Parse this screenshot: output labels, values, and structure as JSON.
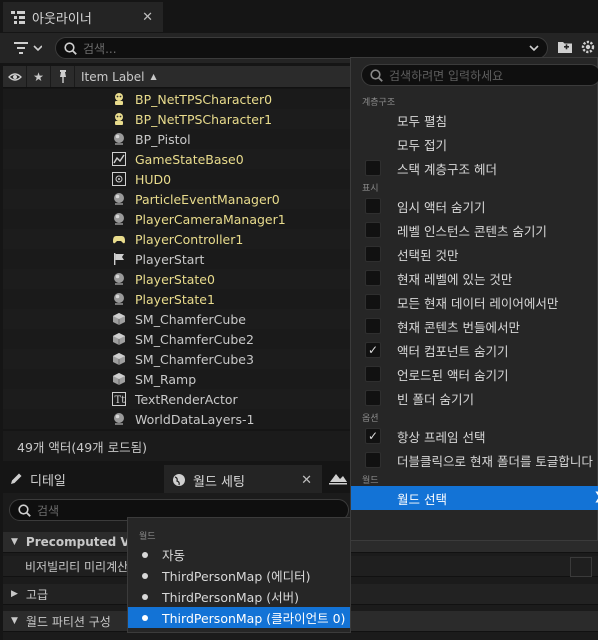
{
  "outliner": {
    "tab_title": "아웃라이너",
    "close_glyph": "✕",
    "search_placeholder": "검색...",
    "columns": {
      "item_label": "Item Label"
    },
    "rows": [
      {
        "label": "BP_NetTPSCharacter0",
        "icon": "pawn-icon",
        "highlight": true
      },
      {
        "label": "BP_NetTPSCharacter1",
        "icon": "pawn-icon",
        "highlight": true
      },
      {
        "label": "BP_Pistol",
        "icon": "actor-icon",
        "highlight": false
      },
      {
        "label": "GameStateBase0",
        "icon": "graph-icon",
        "highlight": true
      },
      {
        "label": "HUD0",
        "icon": "hud-icon",
        "highlight": true
      },
      {
        "label": "ParticleEventManager0",
        "icon": "actor-icon",
        "highlight": true
      },
      {
        "label": "PlayerCameraManager1",
        "icon": "actor-icon",
        "highlight": true
      },
      {
        "label": "PlayerController1",
        "icon": "gamepad-icon",
        "highlight": true
      },
      {
        "label": "PlayerStart",
        "icon": "flag-icon",
        "highlight": false
      },
      {
        "label": "PlayerState0",
        "icon": "actor-icon",
        "highlight": true
      },
      {
        "label": "PlayerState1",
        "icon": "actor-icon",
        "highlight": true
      },
      {
        "label": "SM_ChamferCube",
        "icon": "cube-icon",
        "highlight": false
      },
      {
        "label": "SM_ChamferCube2",
        "icon": "cube-icon",
        "highlight": false
      },
      {
        "label": "SM_ChamferCube3",
        "icon": "cube-icon",
        "highlight": false
      },
      {
        "label": "SM_Ramp",
        "icon": "cube-icon",
        "highlight": false
      },
      {
        "label": "TextRenderActor",
        "icon": "text-icon",
        "highlight": false
      },
      {
        "label": "WorldDataLayers-1",
        "icon": "actor-icon",
        "highlight": false
      }
    ],
    "footer_status": "49개 액터(49개 로드됨)"
  },
  "details": {
    "tab_details": "디테일",
    "tab_world_settings": "월드 세팅",
    "close_glyph": "✕",
    "search_placeholder": "검색",
    "rows": [
      "Precomputed Visibil",
      "비저빌리티 미리계산",
      "고급",
      "월드 파티션 구성"
    ]
  },
  "options_menu": {
    "search_placeholder": "검색하려면 입력하세요",
    "sections": [
      {
        "title": "계층구조",
        "items": [
          {
            "label": "모두 펼침",
            "checkbox": false,
            "checked": false
          },
          {
            "label": "모두 접기",
            "checkbox": false,
            "checked": false
          },
          {
            "label": "스택 계층구조 헤더",
            "checkbox": true,
            "checked": false
          }
        ]
      },
      {
        "title": "표시",
        "items": [
          {
            "label": "임시 액터 숨기기",
            "checkbox": true,
            "checked": false
          },
          {
            "label": "레벨 인스턴스 콘텐츠 숨기기",
            "checkbox": true,
            "checked": false
          },
          {
            "label": "선택된 것만",
            "checkbox": true,
            "checked": false
          },
          {
            "label": "현재 레벨에 있는 것만",
            "checkbox": true,
            "checked": false
          },
          {
            "label": "모든 현재 데이터 레이어에서만",
            "checkbox": true,
            "checked": false
          },
          {
            "label": "현재 콘텐츠 번들에서만",
            "checkbox": true,
            "checked": false
          },
          {
            "label": "액터 컴포넌트 숨기기",
            "checkbox": true,
            "checked": true
          },
          {
            "label": "언로드된 액터 숨기기",
            "checkbox": true,
            "checked": false
          },
          {
            "label": "빈 폴더 숨기기",
            "checkbox": true,
            "checked": false
          }
        ]
      },
      {
        "title": "옵션",
        "items": [
          {
            "label": "항상 프레임 선택",
            "checkbox": true,
            "checked": true
          },
          {
            "label": "더블클릭으로 현재 폴더를 토글합니다",
            "checkbox": true,
            "checked": false
          }
        ]
      },
      {
        "title": "월드",
        "items": [
          {
            "label": "월드 선택",
            "checkbox": false,
            "checked": false,
            "selected": true,
            "submenu": true
          }
        ]
      }
    ],
    "check_glyph": "✓",
    "submenu_arrow": "❯"
  },
  "world_submenu": {
    "section": "월드",
    "items": [
      {
        "label": "자동",
        "selected": false
      },
      {
        "label": "ThirdPersonMap (에디터)",
        "selected": false
      },
      {
        "label": "ThirdPersonMap (서버)",
        "selected": false
      },
      {
        "label": "ThirdPersonMap (클라이언트 0)",
        "selected": true
      }
    ]
  },
  "colors": {
    "accent": "#1373d6",
    "highlight_text": "#e9dc8d"
  }
}
